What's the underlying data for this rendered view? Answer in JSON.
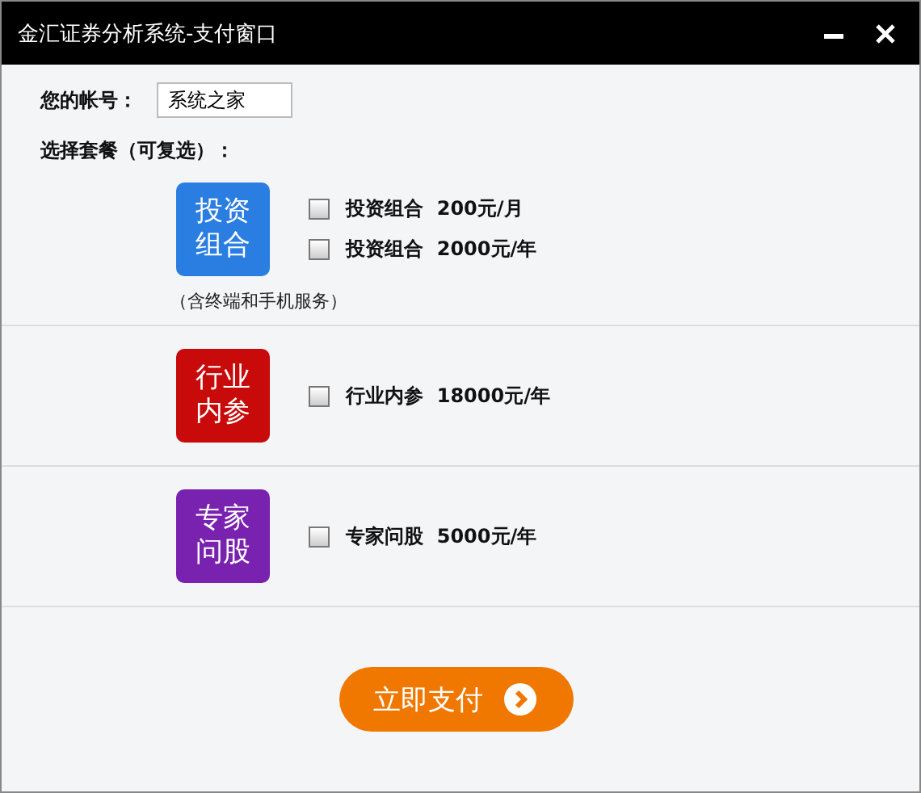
{
  "window": {
    "title": "金汇证券分析系统-支付窗口"
  },
  "account": {
    "label": "您的帐号：",
    "value": "系统之家"
  },
  "choose_label": "选择套餐（可复选）：",
  "packages": [
    {
      "tile": [
        "投资",
        "组合"
      ],
      "color": "#2a7de1",
      "note": "（含终端和手机服务）",
      "options": [
        {
          "label": "投资组合  200元/月",
          "checked": false
        },
        {
          "label": "投资组合  2000元/年",
          "checked": false
        }
      ]
    },
    {
      "tile": [
        "行业",
        "内参"
      ],
      "color": "#c80a0a",
      "options": [
        {
          "label": "行业内参  18000元/年",
          "checked": false
        }
      ]
    },
    {
      "tile": [
        "专家",
        "问股"
      ],
      "color": "#7a22b0",
      "options": [
        {
          "label": "专家问股  5000元/年",
          "checked": false
        }
      ]
    }
  ],
  "pay_button": "立即支付"
}
